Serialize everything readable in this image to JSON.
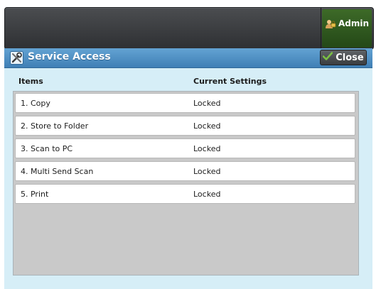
{
  "header": {
    "admin_label": "Admin"
  },
  "panel": {
    "title": "Service Access",
    "close_label": "Close",
    "columns": [
      "Items",
      "Current Settings"
    ],
    "rows": [
      {
        "item": "1. Copy",
        "setting": "Locked"
      },
      {
        "item": "2. Store to Folder",
        "setting": "Locked"
      },
      {
        "item": "3. Scan to PC",
        "setting": "Locked"
      },
      {
        "item": "4. Multi Send Scan",
        "setting": "Locked"
      },
      {
        "item": "5. Print",
        "setting": "Locked"
      }
    ]
  },
  "icons": {
    "admin": "admin-user-icon",
    "title": "tools-icon",
    "close": "checkmark-icon"
  },
  "colors": {
    "titlebar": "#4f8fc4",
    "panel_bg": "#d6eef7",
    "admin_btn": "#2f5a1f",
    "checkmark": "#7bc043"
  }
}
